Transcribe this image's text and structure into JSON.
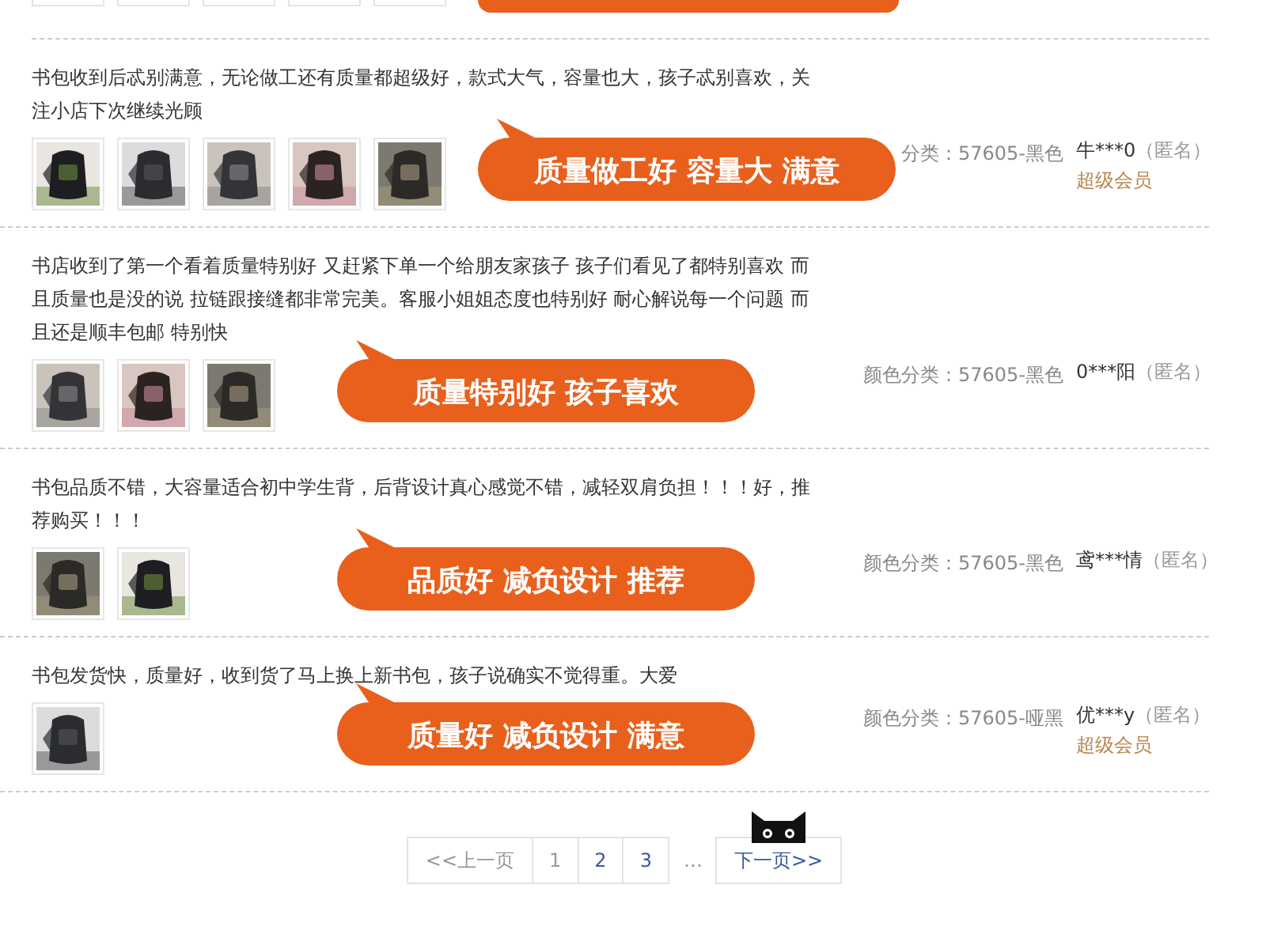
{
  "top_review": {
    "bubble": {
      "kind": "speech-bubble"
    }
  },
  "reviews": [
    {
      "text": "书包收到后忒别满意，无论做工还有质量都超级好，款式大气，容量也大，孩子忒别喜欢，关注小店下次继续光顾",
      "badge": "质量做工好 容量大 满意",
      "color_class": "分类：57605-黑色",
      "user": "牛***0",
      "anon": "（匿名）",
      "vip": "超级会员"
    },
    {
      "text": "书店收到了第一个看着质量特别好 又赶紧下单一个给朋友家孩子 孩子们看见了都特别喜欢 而且质量也是没的说 拉链跟接缝都非常完美。客服小姐姐态度也特别好 耐心解说每一个问题 而且还是顺丰包邮 特别快",
      "badge": "质量特别好 孩子喜欢",
      "color_class": "颜色分类：57605-黑色",
      "user": "0***阳",
      "anon": "（匿名）"
    },
    {
      "text": "书包品质不错，大容量适合初中学生背，后背设计真心感觉不错，减轻双肩负担！！！好，推荐购买！！！",
      "badge": "品质好 减负设计 推荐",
      "color_class": "颜色分类：57605-黑色",
      "user": "鸢***情",
      "anon": "（匿名）"
    },
    {
      "text": "书包发货快，质量好，收到货了马上换上新书包，孩子说确实不觉得重。大爱",
      "badge": "质量好 减负设计 满意",
      "color_class": "颜色分类：57605-哑黑",
      "user": "优***y",
      "anon": "（匿名）",
      "vip": "超级会员"
    }
  ],
  "pagination": [
    {
      "kind": "prev",
      "label": "<<上一页",
      "disabled": true
    },
    {
      "kind": "page",
      "label": "1",
      "selected": true
    },
    {
      "kind": "page",
      "label": "2",
      "selected": false
    },
    {
      "kind": "page",
      "label": "3",
      "selected": false
    },
    {
      "kind": "ellipsis",
      "label": "…"
    },
    {
      "kind": "next",
      "label": "下一页>>",
      "disabled": false
    }
  ]
}
